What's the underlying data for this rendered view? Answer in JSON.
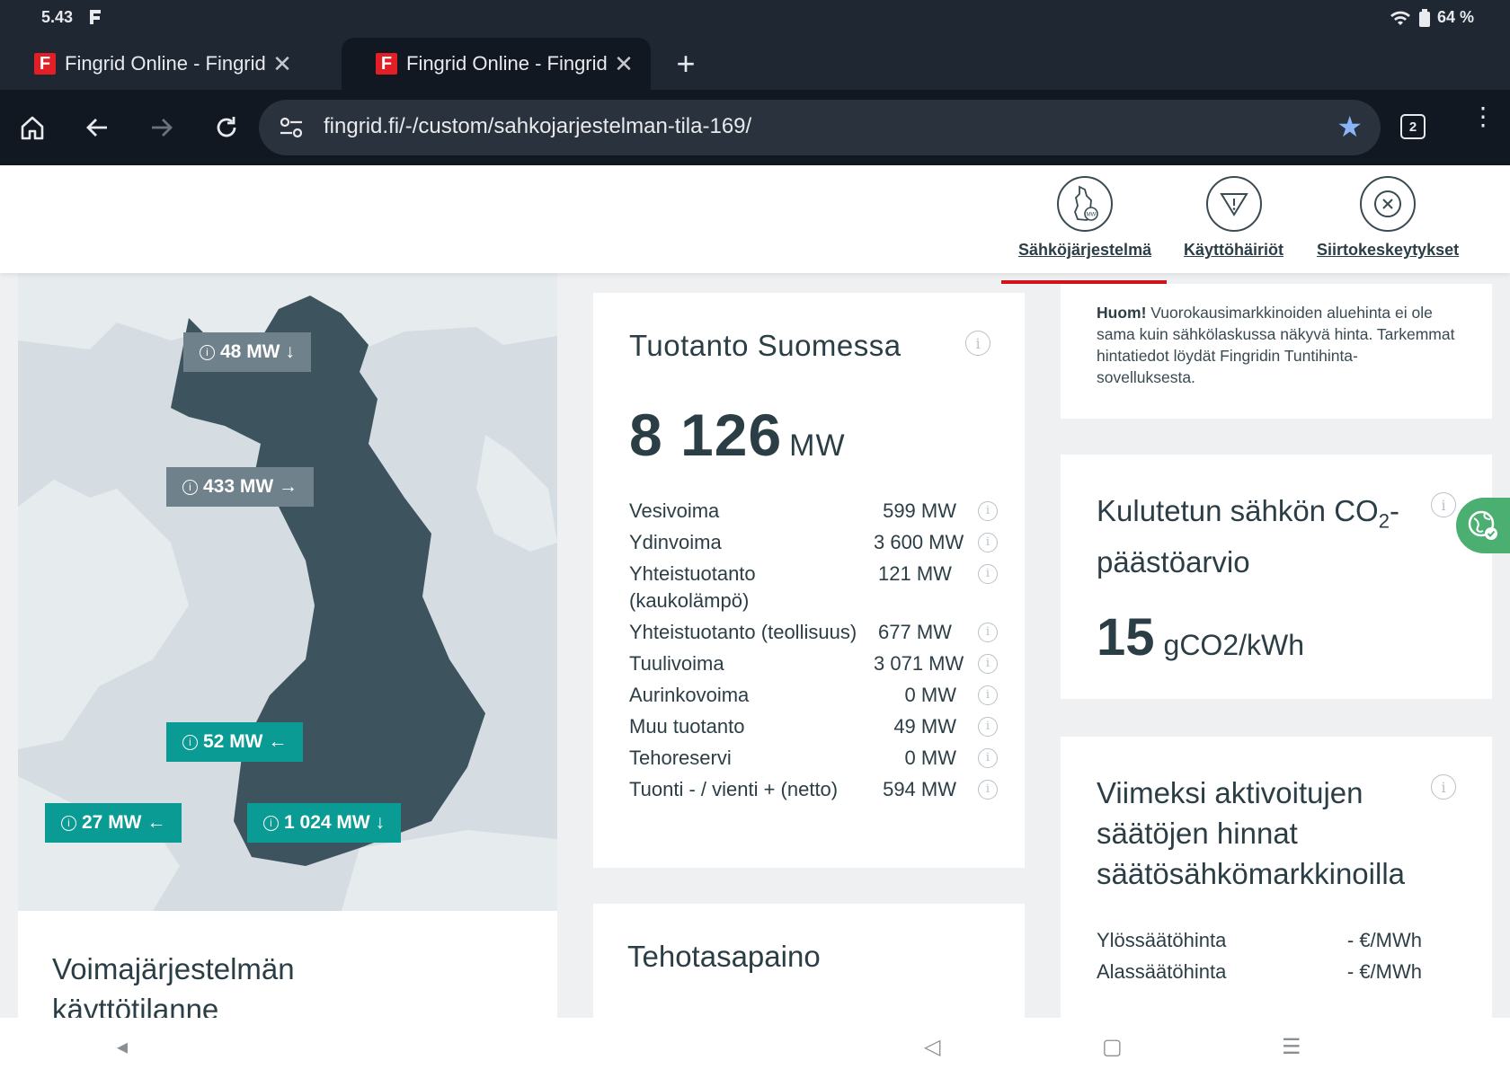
{
  "status": {
    "time": "5.43",
    "battery": "64 %"
  },
  "tabs": [
    {
      "title": "Fingrid Online - Fingrid",
      "favicon": "F",
      "active": false
    },
    {
      "title": "Fingrid Online - Fingrid",
      "favicon": "F",
      "active": true
    }
  ],
  "toolbar": {
    "url": "fingrid.fi/-/custom/sahkojarjestelman-tila-169/",
    "tab_count": "2"
  },
  "nav": [
    {
      "label": "Sähköjärjestelmä",
      "icon": "finland-map-icon",
      "active": true
    },
    {
      "label": "Käyttöhäiriöt",
      "icon": "warning-icon",
      "active": false
    },
    {
      "label": "Siirtokeskeytykset",
      "icon": "close-circle-icon",
      "active": false
    }
  ],
  "map": {
    "flows": [
      {
        "value": "48 MW",
        "arrow": "↓",
        "style": "grey"
      },
      {
        "value": "433 MW",
        "arrow": "→",
        "style": "grey"
      },
      {
        "value": "52 MW",
        "arrow": "←",
        "style": "teal"
      },
      {
        "value": "27 MW",
        "arrow": "←",
        "style": "teal"
      },
      {
        "value": "1 024 MW",
        "arrow": "↓",
        "style": "teal"
      }
    ]
  },
  "production": {
    "title": "Tuotanto Suomessa",
    "total": "8 126",
    "unit": "MW",
    "rows": [
      {
        "name": "Vesivoima",
        "value": "599 MW"
      },
      {
        "name": "Ydinvoima",
        "value": "3 600 MW"
      },
      {
        "name": "Yhteistuotanto (kaukolämpö)",
        "value": "121 MW"
      },
      {
        "name": "Yhteistuotanto (teollisuus)",
        "value": "677 MW"
      },
      {
        "name": "Tuulivoima",
        "value": "3 071 MW"
      },
      {
        "name": "Aurinkovoima",
        "value": "0 MW"
      },
      {
        "name": "Muu tuotanto",
        "value": "49 MW"
      },
      {
        "name": "Tehoreservi",
        "value": "0 MW"
      },
      {
        "name": "Tuonti - / vienti + (netto)",
        "value": "594 MW"
      }
    ]
  },
  "power_system_title": "Voimajärjestelmän käyttötilanne",
  "balance_title": "Tehotasapaino",
  "notice": {
    "bold": "Huom!",
    "text": " Vuorokausimarkkinoiden aluehinta ei ole sama kuin sähkölaskussa näkyvä hinta. Tarkemmat hintatiedot löydät Fingridin Tuntihinta-sovelluksesta."
  },
  "co2": {
    "title_a": "Kulutetun sähkön CO",
    "title_sub": "2",
    "title_b": "-päästöarvio",
    "value": "15",
    "unit": "gCO2/kWh"
  },
  "balancing": {
    "title": "Viimeksi aktivoitujen säätöjen hinnat säätösähkömarkkinoilla",
    "rows": [
      {
        "label": "Ylössäätöhinta",
        "value": "- €/MWh"
      },
      {
        "label": "Alassäätöhinta",
        "value": "- €/MWh"
      }
    ]
  },
  "colors": {
    "accent": "#d0131a",
    "teal": "#0a9b94",
    "map_land": "#3d535e",
    "grey_label": "#6f818b"
  }
}
